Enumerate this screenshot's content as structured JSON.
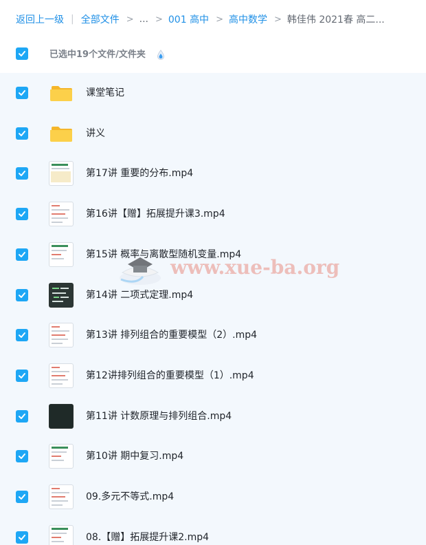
{
  "breadcrumb": {
    "back": "返回上一级",
    "all_files": "全部文件",
    "ellipsis": "...",
    "level1": "001 高中",
    "level2": "高中数学",
    "current": "韩佳伟 2021春 高二..."
  },
  "selection": {
    "text": "已选中19个文件/文件夹",
    "checked": true
  },
  "files": [
    {
      "name": "课堂笔记",
      "type": "folder",
      "checked": true
    },
    {
      "name": "讲义",
      "type": "folder",
      "checked": true
    },
    {
      "name": "第17讲 重要的分布.mp4",
      "type": "video",
      "checked": true
    },
    {
      "name": "第16讲【赠】拓展提升课3.mp4",
      "type": "video",
      "checked": true
    },
    {
      "name": "第15讲 概率与离散型随机变量.mp4",
      "type": "video",
      "checked": true
    },
    {
      "name": "第14讲 二项式定理.mp4",
      "type": "video",
      "checked": true
    },
    {
      "name": "第13讲 排列组合的重要模型（2）.mp4",
      "type": "video",
      "checked": true
    },
    {
      "name": "第12讲排列组合的重要模型（1）.mp4",
      "type": "video",
      "checked": true
    },
    {
      "name": "第11讲 计数原理与排列组合.mp4",
      "type": "video",
      "checked": true
    },
    {
      "name": "第10讲 期中复习.mp4",
      "type": "video",
      "checked": true
    },
    {
      "name": "09.多元不等式.mp4",
      "type": "video",
      "checked": true
    },
    {
      "name": "08.【赠】拓展提升课2.mp4",
      "type": "video",
      "checked": true
    }
  ],
  "watermark": "www.xue-ba.org",
  "colors": {
    "accent": "#1ea7f5",
    "link": "#1e8fe6",
    "list_bg": "#f3f8fd",
    "folder": "#fbc73a"
  }
}
